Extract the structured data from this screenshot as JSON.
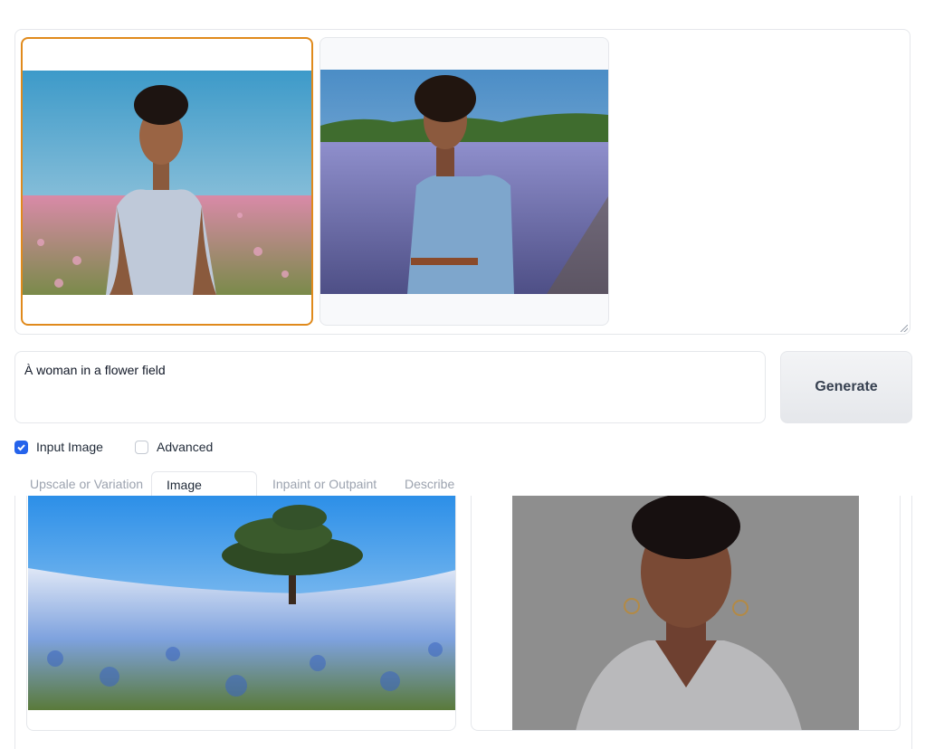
{
  "gallery": {
    "images": [
      {
        "icon": "woman-pink-flower-field-image",
        "selected": true
      },
      {
        "icon": "woman-blue-flower-field-image",
        "selected": false
      }
    ]
  },
  "prompt": {
    "value": "À woman in a flower field"
  },
  "generate": {
    "label": "Generate"
  },
  "options": {
    "input_image": {
      "label": "Input Image",
      "checked": true
    },
    "advanced": {
      "label": "Advanced",
      "checked": false
    }
  },
  "tabs": [
    {
      "label": "Upscale or Variation",
      "active": false
    },
    {
      "label": "Image Prompt",
      "active": true
    },
    {
      "label": "Inpaint or Outpaint",
      "active": false
    },
    {
      "label": "Describe",
      "active": false
    }
  ],
  "image_prompts": [
    {
      "icon": "tree-blue-flower-field-image"
    },
    {
      "icon": "woman-portrait-image"
    }
  ],
  "colors": {
    "accent": "#e08a1c",
    "checkbox": "#2563eb"
  }
}
